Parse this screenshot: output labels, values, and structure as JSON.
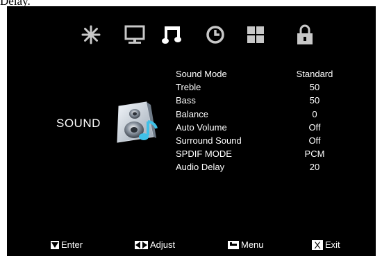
{
  "caption_fragment": "Delay.",
  "tabs": [
    {
      "icon": "snowflake-icon",
      "name": "tab-picture"
    },
    {
      "icon": "monitor-icon",
      "name": "tab-screen"
    },
    {
      "icon": "music-note-icon",
      "name": "tab-sound",
      "active": true
    },
    {
      "icon": "clock-icon",
      "name": "tab-time"
    },
    {
      "icon": "grid-icon",
      "name": "tab-setup"
    },
    {
      "icon": "lock-icon",
      "name": "tab-lock"
    }
  ],
  "section_title": "SOUND",
  "section_icon": "speaker-icon",
  "menu": [
    {
      "label": "Sound Mode",
      "value": "Standard"
    },
    {
      "label": "Treble",
      "value": "50"
    },
    {
      "label": "Bass",
      "value": "50"
    },
    {
      "label": "Balance",
      "value": "0"
    },
    {
      "label": "Auto Volume",
      "value": "Off"
    },
    {
      "label": "Surround Sound",
      "value": "Off"
    },
    {
      "label": "SPDIF MODE",
      "value": "PCM"
    },
    {
      "label": "Audio Delay",
      "value": "20"
    }
  ],
  "footer": {
    "enter": {
      "icon": "down-arrow-icon",
      "label": "Enter"
    },
    "adjust": {
      "icon": "left-right-arrows-icon",
      "label": "Adjust"
    },
    "menu": {
      "icon": "menu-key-icon",
      "label": "Menu"
    },
    "exit": {
      "icon": "x-key-icon",
      "key": "X",
      "label": "Exit"
    }
  },
  "colors": {
    "background": "#000000",
    "text": "#ffffff",
    "icon_inactive": "#c8c8c8",
    "icon_active": "#ffffff"
  }
}
